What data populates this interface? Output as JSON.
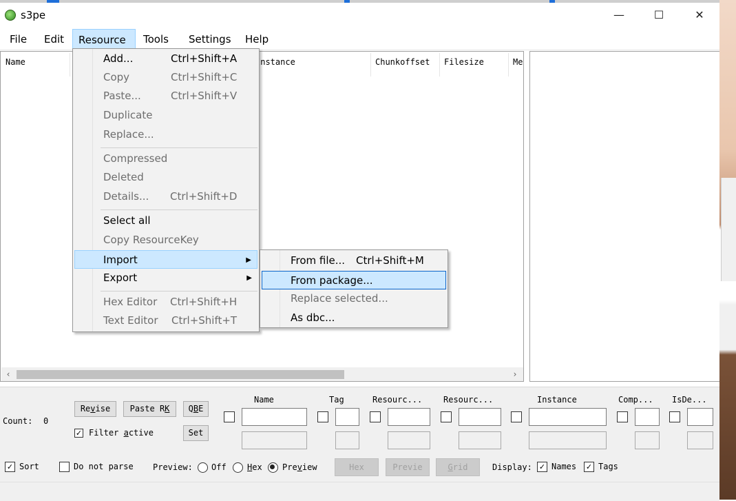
{
  "window": {
    "title": "s3pe",
    "minimize_glyph": "—",
    "maximize_glyph": "☐",
    "close_glyph": "✕",
    "icon": "s3pe-app-icon"
  },
  "menubar": {
    "file": "File",
    "edit": "Edit",
    "resource": "Resource",
    "tools": "Tools",
    "settings": "Settings",
    "help": "Help"
  },
  "list": {
    "columns": {
      "name": "Name",
      "instance": "Instance",
      "chunkoffset": "Chunkoffset",
      "filesize": "Filesize",
      "me": "Me"
    },
    "scroll_left": "‹",
    "scroll_right": "›"
  },
  "resource_menu": {
    "add": {
      "label": "Add...",
      "shortcut": "Ctrl+Shift+A"
    },
    "copy": {
      "label": "Copy",
      "shortcut": "Ctrl+Shift+C"
    },
    "paste": {
      "label": "Paste...",
      "shortcut": "Ctrl+Shift+V"
    },
    "duplicate": {
      "label": "Duplicate"
    },
    "replace": {
      "label": "Replace..."
    },
    "compressed": {
      "label": "Compressed"
    },
    "deleted": {
      "label": "Deleted"
    },
    "details": {
      "label": "Details...",
      "shortcut": "Ctrl+Shift+D"
    },
    "select_all": {
      "label": "Select all"
    },
    "copy_resourcekey": {
      "label": "Copy ResourceKey"
    },
    "import": {
      "label": "Import",
      "arrow": "▶"
    },
    "export": {
      "label": "Export",
      "arrow": "▶"
    },
    "hex_editor": {
      "label": "Hex Editor",
      "shortcut": "Ctrl+Shift+H"
    },
    "text_editor": {
      "label": "Text Editor",
      "shortcut": "Ctrl+Shift+T"
    }
  },
  "import_submenu": {
    "from_file": {
      "label": "From file...",
      "shortcut": "Ctrl+Shift+M"
    },
    "from_package": {
      "label": "From package..."
    },
    "replace_selected": {
      "label": "Replace selected..."
    },
    "as_dbc": {
      "label": "As dbc..."
    }
  },
  "bottom": {
    "count_label": "Count:",
    "count_value": "0",
    "revise_pre": "Re",
    "revise_u": "v",
    "revise_post": "ise",
    "paste_rk_pre": "Paste R",
    "paste_rk_u": "K",
    "qbe_pre": "Q",
    "qbe_u": "B",
    "qbe_post": "E",
    "filter_pre": "Filter ",
    "filter_u": "a",
    "filter_post": "ctive",
    "set": "Set",
    "filter_cols": {
      "name": "Name",
      "tag": "Tag",
      "resource1": "Resourc...",
      "resource2": "Resourc...",
      "instance": "Instance",
      "comp": "Comp...",
      "isde": "IsDe..."
    },
    "sort": "Sort",
    "do_not_parse": "Do not parse",
    "preview_label": "Preview:",
    "preview_off": "Off",
    "preview_hex_u": "H",
    "preview_hex_post": "ex",
    "preview_preview_pre": "Pre",
    "preview_preview_u": "v",
    "preview_preview_post": "iew",
    "hex_btn": "Hex",
    "previe_btn": "Previe",
    "grid_btn_u": "G",
    "grid_btn_post": "rid",
    "display_label": "Display:",
    "names": "Names",
    "tags": "Tags",
    "check_glyph": "✓"
  },
  "colors": {
    "highlight": "#cce8ff",
    "highlight_border": "#99d1ff",
    "menu_bg": "#f2f2f2",
    "panel_bg": "#f0f0f0"
  }
}
